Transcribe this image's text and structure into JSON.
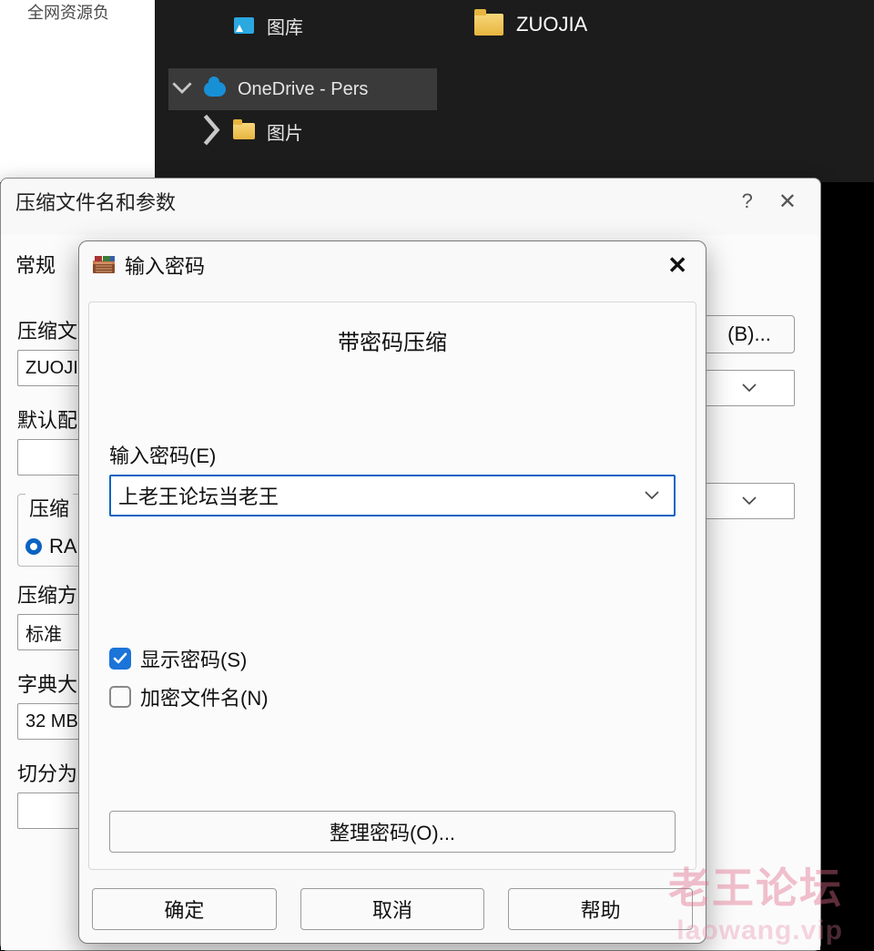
{
  "explorer": {
    "left_partial_text": "全网资源负",
    "tree": {
      "pictures": "图库",
      "onedrive": "OneDrive - Pers",
      "sub_pictures": "图片"
    },
    "content_folder": "ZUOJIA"
  },
  "archive_dialog": {
    "title": "压缩文件名和参数",
    "help": "?",
    "close": "✕",
    "tab_general": "常规",
    "label_archive_name": "压缩文",
    "archive_name_value": "ZUOJIA",
    "label_default_profile": "默认配",
    "group_format_label": "压缩",
    "radio_rar": "RA",
    "label_method": "压缩方",
    "method_value": "标准",
    "label_dict": "字典大",
    "dict_value": "32 MB",
    "label_split": "切分为",
    "browse_label": "(B)..."
  },
  "password_dialog": {
    "title": "输入密码",
    "close": "✕",
    "heading": "带密码压缩",
    "label_enter": "输入密码(E)",
    "password_value": "上老王论坛当老王",
    "checkbox_show": "显示密码(S)",
    "checkbox_encrypt": "加密文件名(N)",
    "organize_button": "整理密码(O)...",
    "ok": "确定",
    "cancel": "取消",
    "help": "帮助"
  },
  "watermark": {
    "big": "老王论坛",
    "small": "laowang.vip"
  }
}
